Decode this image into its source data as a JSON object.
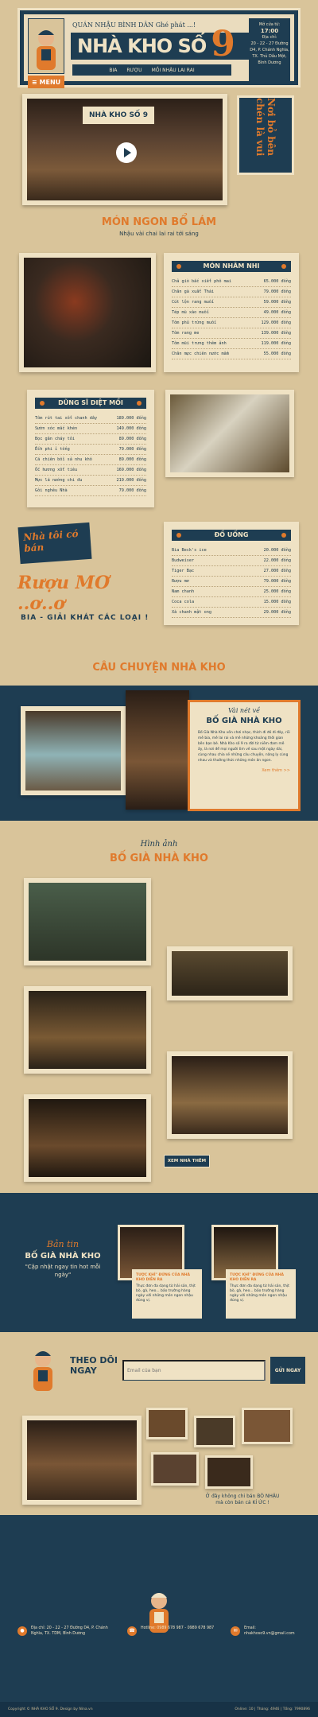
{
  "header": {
    "tagline": "QUÁN NHẬU BÌNH DÂN  Ghé phát ...!",
    "brand_text": "NHÀ KHO SỐ",
    "brand_number": "9",
    "menu_label": "MENU",
    "nav": [
      "BIA",
      "RƯỢU",
      "MỒI NHẬU LAI RAI"
    ],
    "hours_label": "Mở cửa từ:",
    "hours_value": "17:00",
    "address_label": "Địa chỉ:",
    "address_value": "20 - 22 - 27 Đường D4, P. Chánh Nghĩa, TX. Thủ Dầu Một, Bình Dương"
  },
  "hero": {
    "side_title": "Nơi bỏ bên chén là vui"
  },
  "section_mon_ngon": {
    "title": "MÓN NGON BỔ LÁM",
    "subtitle": "Nhậu vài chai lai rai tới sáng"
  },
  "menu_mon_nham_nhi": {
    "title": "MÓN NHÂM NHI",
    "items": [
      {
        "name": "Chả giò bắc xiết phô mai",
        "price": "65.000 đồng"
      },
      {
        "name": "Chân gà xuất Thái",
        "price": "79.000 đồng"
      },
      {
        "name": "Cút lộn rang muối",
        "price": "59.000 đồng"
      },
      {
        "name": "Tép mù xào muối",
        "price": "49.000 đồng"
      },
      {
        "name": "Tôm phủ trứng muối",
        "price": "129.000 đồng"
      },
      {
        "name": "Tôm rang me",
        "price": "139.000 đồng"
      },
      {
        "name": "Tôm mũi trưng thêm ảnh",
        "price": "119.000 đồng"
      },
      {
        "name": "Chân mực chiên nước mắm",
        "price": "55.000 đồng"
      }
    ]
  },
  "menu_dung_si": {
    "title": "DŨNG SĨ DIỆT MỒI",
    "items": [
      {
        "name": "Tôm rút tai xốt chanh dây",
        "price": "189.000 đồng"
      },
      {
        "name": "Sườn xóc mắc khén",
        "price": "149.000 đồng"
      },
      {
        "name": "Bọc gân cháy tỏi",
        "price": "89.000 đồng"
      },
      {
        "name": "Ếch phi ỉ tống",
        "price": "79.000 đồng"
      },
      {
        "name": "Cá chiên bồi sả nhu khô",
        "price": "89.000 đồng"
      },
      {
        "name": "Ốc hương xốt tiêu",
        "price": "169.000 đồng"
      },
      {
        "name": "Mực lá nướng chi đu",
        "price": "219.000 đồng"
      },
      {
        "name": "Gỏi nghêu Nhà",
        "price": "79.000 đồng"
      }
    ]
  },
  "menu_do_uong": {
    "title": "ĐỒ UỐNG",
    "items": [
      {
        "name": "Bia Beck's ice",
        "price": "20.000 đồng"
      },
      {
        "name": "Budweiser",
        "price": "22.000 đồng"
      },
      {
        "name": "Tiger Bạc",
        "price": "27.000 đồng"
      },
      {
        "name": "Rượu mơ",
        "price": "79.000 đồng"
      },
      {
        "name": "Nam chanh",
        "price": "25.000 đồng"
      },
      {
        "name": "Coca cola",
        "price": "15.000 đồng"
      },
      {
        "name": "Xà chanh mật ong",
        "price": "29.000 đồng"
      }
    ]
  },
  "promo": {
    "line1": "Nhà tôi có bán",
    "line2": "Rượu MƠ ..ơ..ơ",
    "line3": "BIA - GIẢI KHÁT CÁC LOẠI !"
  },
  "story": {
    "title": "CÂU CHUYỆN NHÀ KHO",
    "box_small": "Vài nét về",
    "box_big": "BỐ GIÀ NHÀ KHO",
    "body": "Bố Già Nhà Kho vốn chơi nhạc, thích đi đó đi đây, rồi mê bia, mê lai rai và mê những khoảng thời gian bên bạn bè. Nhà Kho số 9 ra đời từ niềm đam mê ấy, là nơi để mọi người tìm về sau một ngày dài, cùng nhau chia sẻ những câu chuyện, nâng ly cùng nhau và thưởng thức những món ăn ngon.",
    "more": "Xem thêm >>"
  },
  "gallery": {
    "sub": "Hình ảnh",
    "title": "BỐ GIÀ NHÀ KHO",
    "button": "XEM NHÀ THÊM"
  },
  "news": {
    "small": "Bản tin",
    "big": "BỐ GIÀ NHÀ KHO",
    "quote": "\"Cập nhật ngay tin hot mỗi ngày\"",
    "cards": [
      {
        "title": "TƯỢC KHỈ\" ĐỨNG CỦA NHÀ KHO DIỄN RA",
        "body": "Thực đơn đa dạng từ hải sản, thịt bò, gà, heo... bảo trường hàng ngày với những món ngon nhậu đúng vị."
      },
      {
        "title": "TƯỢC KHỈ\" ĐỨNG CỦA NHÀ KHO DIỄN RA",
        "body": "Thực đơn đa dạng từ hải sản, thịt bò, gà, heo... bảo trường hàng ngày với những món ngon nhậu đúng vị."
      }
    ]
  },
  "follow": {
    "title": "THEO DÕI NGAY",
    "placeholder": "Email của bạn",
    "button": "GỬI NGAY"
  },
  "closing": {
    "line1": "Ở đây không chỉ bán BÒ NHẬU",
    "line2": "mà còn bán cả KÍ ỨC !"
  },
  "footer": {
    "address": "Địa chỉ: 20 - 22 - 27 Đường D4, P. Chánh Nghĩa, TX. TDM, Bình Dương",
    "hotline": "Hotline: 0989 678 987 - 0989 678 987",
    "email": "Email: nhakhoso9.vn@gmail.com",
    "copyright": "Copyright © NHÀ KHO SỐ 9. Design by Nina.vn",
    "stats": "Online: 10  |  Tháng: 4946  |  Tổng: 7990896"
  },
  "colors": {
    "navy": "#1e3d52",
    "orange": "#e07a2c",
    "paper": "#eadcbe"
  }
}
